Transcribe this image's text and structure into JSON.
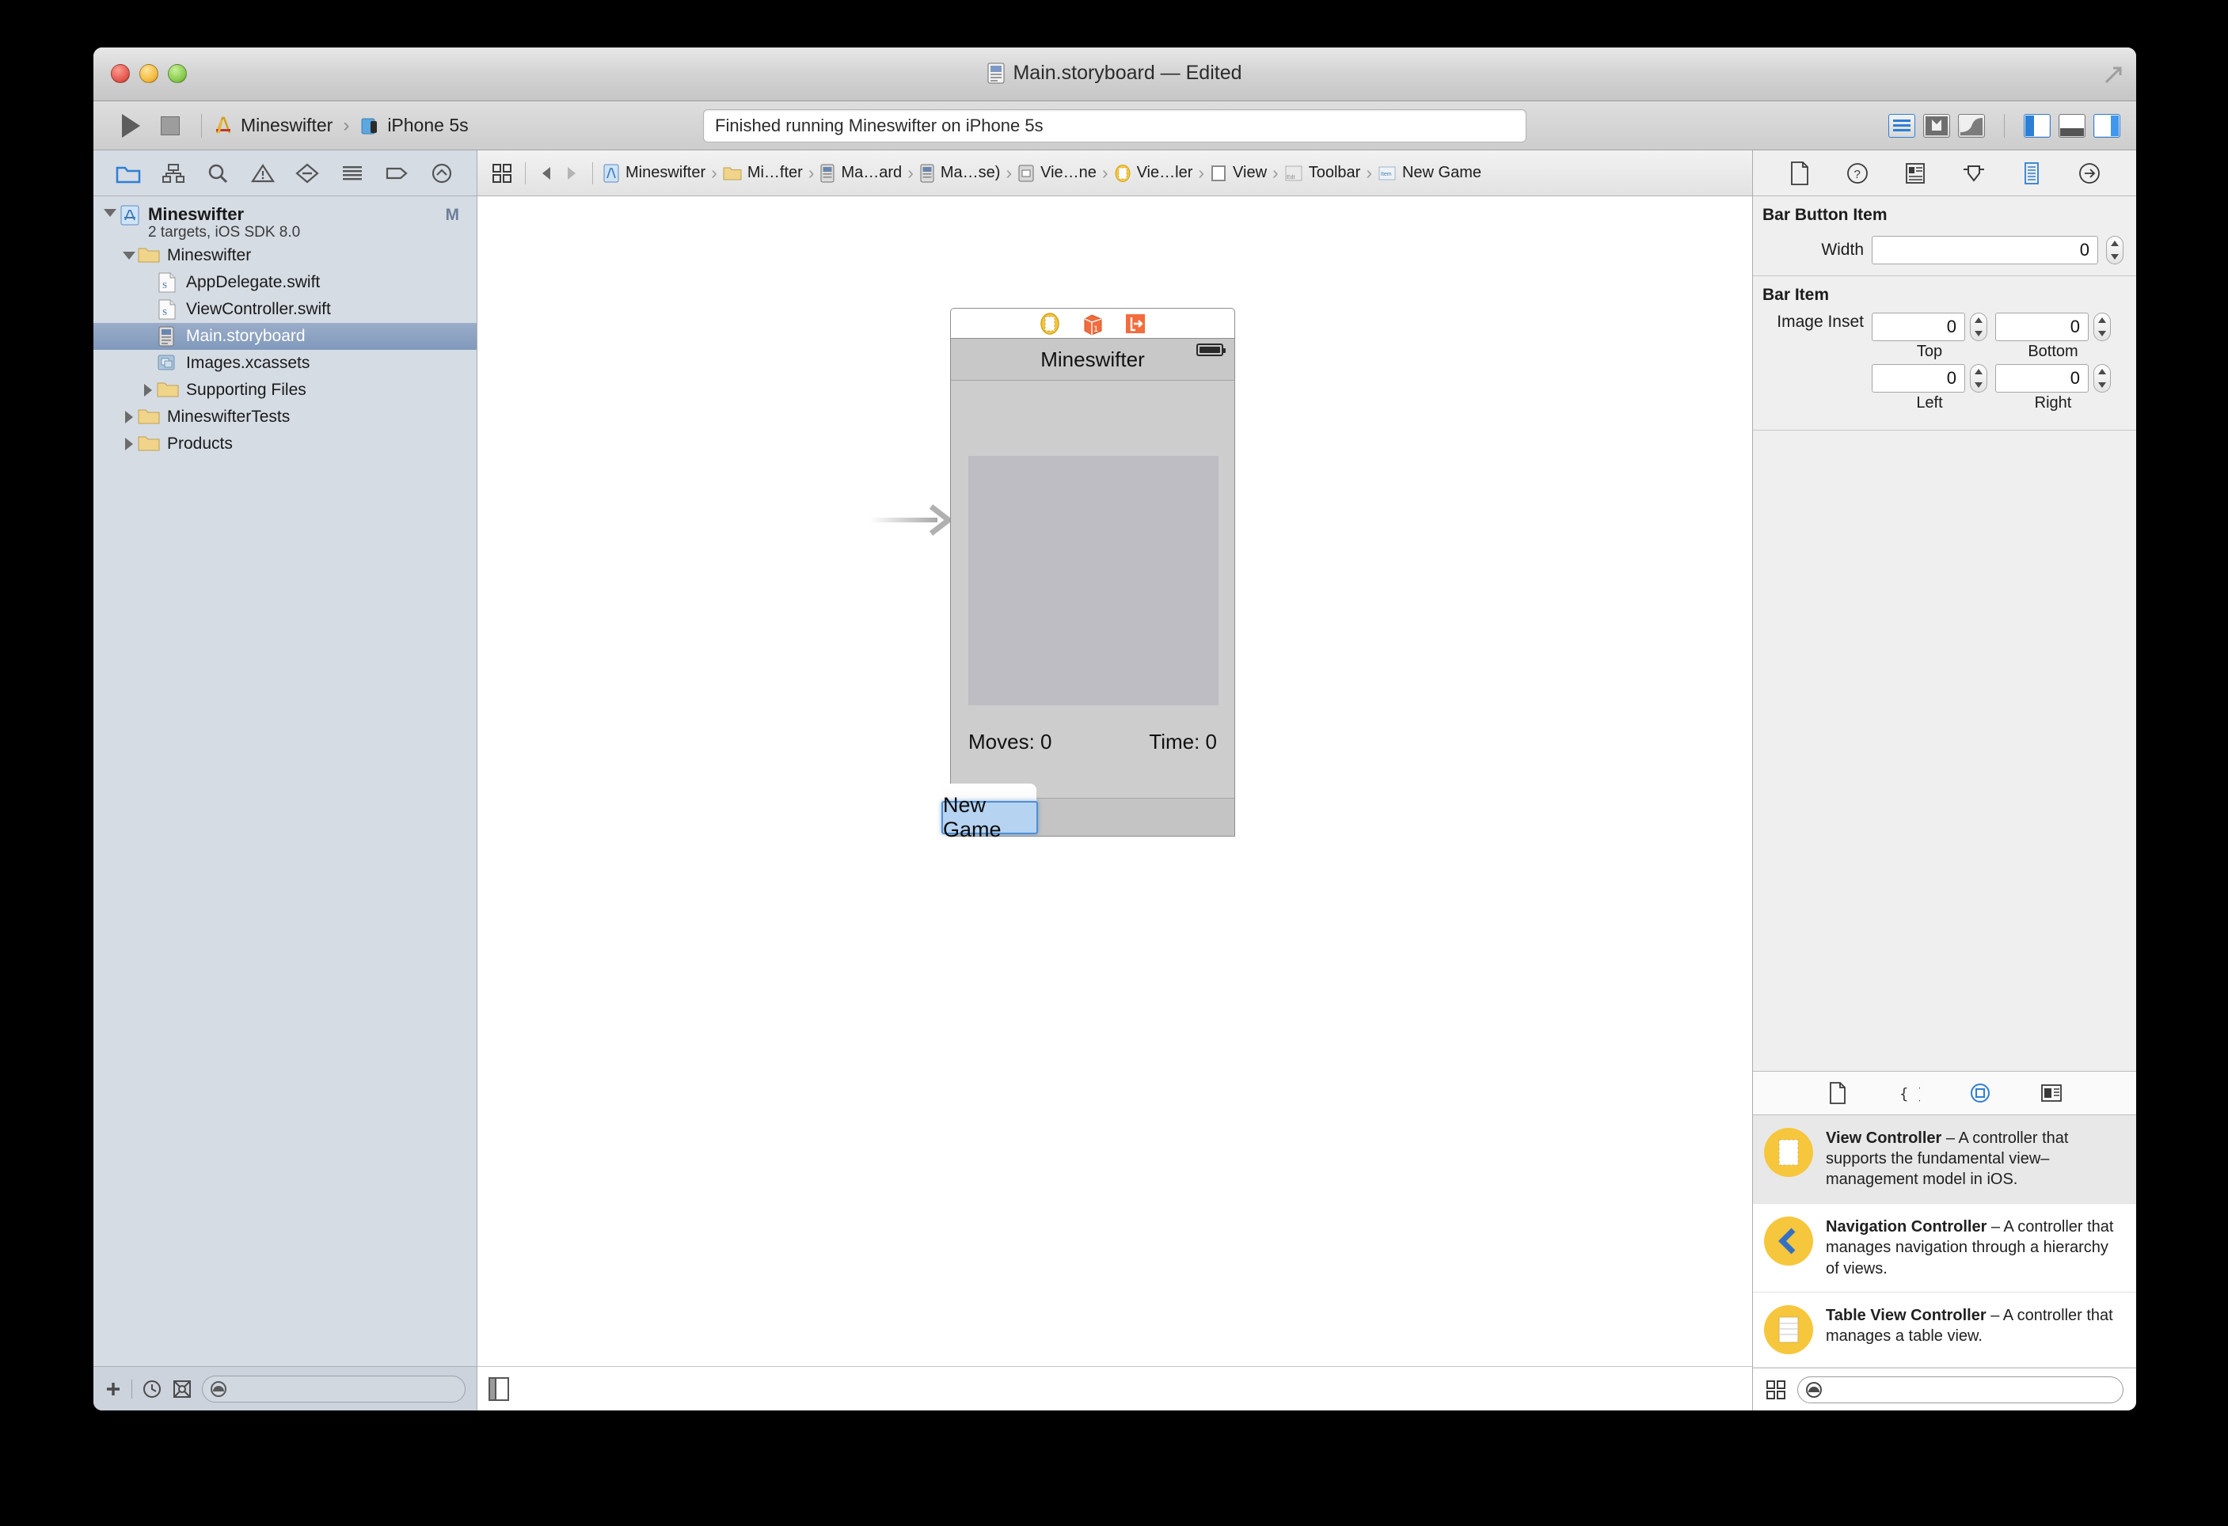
{
  "window": {
    "title": "Main.storyboard — Edited",
    "title_icon": "storyboard-file-icon"
  },
  "toolbar": {
    "run_label": "Run",
    "stop_label": "Stop",
    "scheme_project": "Mineswifter",
    "scheme_destination": "iPhone 5s",
    "scheme_chevron": "›",
    "activity_status": "Finished running Mineswifter on iPhone 5s",
    "editor_buttons": [
      "standard-editor",
      "assistant-editor",
      "version-editor"
    ],
    "view_buttons": [
      "navigator-toggle",
      "debug-toggle",
      "utilities-toggle"
    ]
  },
  "navigator": {
    "tabs": [
      "project-navigator-icon",
      "symbol-navigator-icon",
      "find-navigator-icon",
      "issue-navigator-icon",
      "test-navigator-icon",
      "debug-navigator-icon",
      "breakpoint-navigator-icon",
      "report-navigator-icon"
    ],
    "project": {
      "name": "Mineswifter",
      "subtitle": "2 targets, iOS SDK 8.0",
      "status_badge": "M"
    },
    "items": [
      {
        "label": "Mineswifter",
        "icon": "folder-icon",
        "indent": 1,
        "twisty": "open",
        "selected": false
      },
      {
        "label": "AppDelegate.swift",
        "icon": "swift-file-icon",
        "indent": 2,
        "twisty": "none",
        "selected": false
      },
      {
        "label": "ViewController.swift",
        "icon": "swift-file-icon",
        "indent": 2,
        "twisty": "none",
        "selected": false
      },
      {
        "label": "Main.storyboard",
        "icon": "storyboard-file-icon",
        "indent": 2,
        "twisty": "none",
        "selected": true
      },
      {
        "label": "Images.xcassets",
        "icon": "xcassets-icon",
        "indent": 2,
        "twisty": "none",
        "selected": false
      },
      {
        "label": "Supporting Files",
        "icon": "folder-icon",
        "indent": 2,
        "twisty": "closed",
        "selected": false
      },
      {
        "label": "MineswifterTests",
        "icon": "folder-icon",
        "indent": 1,
        "twisty": "closed",
        "selected": false
      },
      {
        "label": "Products",
        "icon": "folder-icon",
        "indent": 1,
        "twisty": "closed",
        "selected": false
      }
    ],
    "bottom_bar": {
      "add_icon": "plus-icon",
      "recent_icon": "clock-icon",
      "filter_icon": "source-control-filter-icon",
      "filter_placeholder": ""
    }
  },
  "editor": {
    "jumpbar": {
      "grid_icon": "related-items-icon",
      "back_icon": "back-arrow-icon",
      "forward_icon": "forward-arrow-icon",
      "crumbs": [
        {
          "label": "Mineswifter",
          "icon": "project-icon"
        },
        {
          "label": "Mi…fter",
          "icon": "folder-icon"
        },
        {
          "label": "Ma…ard",
          "icon": "storyboard-file-icon"
        },
        {
          "label": "Ma…se)",
          "icon": "storyboard-file-icon"
        },
        {
          "label": "Vie…ne",
          "icon": "scene-icon"
        },
        {
          "label": "Vie…ler",
          "icon": "view-controller-icon"
        },
        {
          "label": "View",
          "icon": "view-icon"
        },
        {
          "label": "Toolbar",
          "icon": "toolbar-icon"
        },
        {
          "label": "New Game",
          "icon": "bar-button-item-icon"
        }
      ]
    },
    "scene": {
      "dock_icons": [
        "view-controller-icon",
        "first-responder-icon",
        "exit-icon"
      ],
      "navbar_title": "Mineswifter",
      "battery_icon": "battery-icon",
      "moves_label": "Moves: 0",
      "time_label": "Time: 0",
      "editing_button_text": "New Game"
    },
    "bottom_bar": {
      "document_outline_icon": "document-outline-icon"
    }
  },
  "utilities": {
    "inspector_tabs": [
      "file-inspector-icon",
      "quick-help-icon",
      "identity-inspector-icon",
      "attributes-inspector-icon",
      "size-inspector-icon",
      "connections-inspector-icon"
    ],
    "sections": [
      {
        "title": "Bar Button Item",
        "fields": [
          {
            "label": "Width",
            "value": "0"
          }
        ]
      },
      {
        "title": "Bar Item",
        "inset_label": "Image Inset",
        "insets": [
          {
            "caption": "Top",
            "value": "0"
          },
          {
            "caption": "Bottom",
            "value": "0"
          },
          {
            "caption": "Left",
            "value": "0"
          },
          {
            "caption": "Right",
            "value": "0"
          }
        ]
      }
    ],
    "library_tabs": [
      "file-template-library-icon",
      "code-snippet-library-icon",
      "object-library-icon",
      "media-library-icon"
    ],
    "library_items": [
      {
        "name": "View Controller",
        "description": " – A controller that supports the fundamental view–management model in iOS.",
        "icon": "view-controller-icon",
        "selected": true
      },
      {
        "name": "Navigation Controller",
        "description": " – A controller that manages navigation through a hierarchy of views.",
        "icon": "navigation-controller-icon",
        "selected": false
      },
      {
        "name": "Table View Controller",
        "description": " – A controller that manages a table view.",
        "icon": "table-view-controller-icon",
        "selected": false
      }
    ],
    "library_bottom": {
      "grid_icon": "grid-view-icon",
      "search_placeholder": ""
    }
  },
  "colors": {
    "accent_blue": "#2d7fd6",
    "selection_blue": "#8099bb",
    "library_yellow": "#f6c63c",
    "scene_orange": "#f26c3d"
  }
}
